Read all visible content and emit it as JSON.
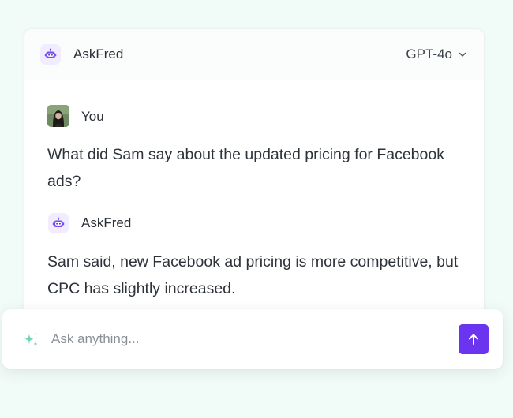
{
  "header": {
    "brand_name": "AskFred",
    "model_selected": "GPT-4o"
  },
  "conversation": {
    "messages": [
      {
        "author": "You",
        "text": "What did Sam say about the updated pricing for Facebook ads?"
      },
      {
        "author": "AskFred",
        "text": "Sam said, new Facebook ad pricing is more competitive, but CPC has slightly increased."
      }
    ]
  },
  "composer": {
    "placeholder": "Ask anything..."
  },
  "icons": {
    "brand": "robot-icon",
    "model_dropdown": "chevron-down-icon",
    "composer": "sparkle-icon",
    "send": "arrow-up-icon"
  },
  "colors": {
    "accent": "#6b35f0",
    "page_background": "#f1fbf8",
    "bot_icon_background": "#f1ecff",
    "text": "#2e333a"
  }
}
